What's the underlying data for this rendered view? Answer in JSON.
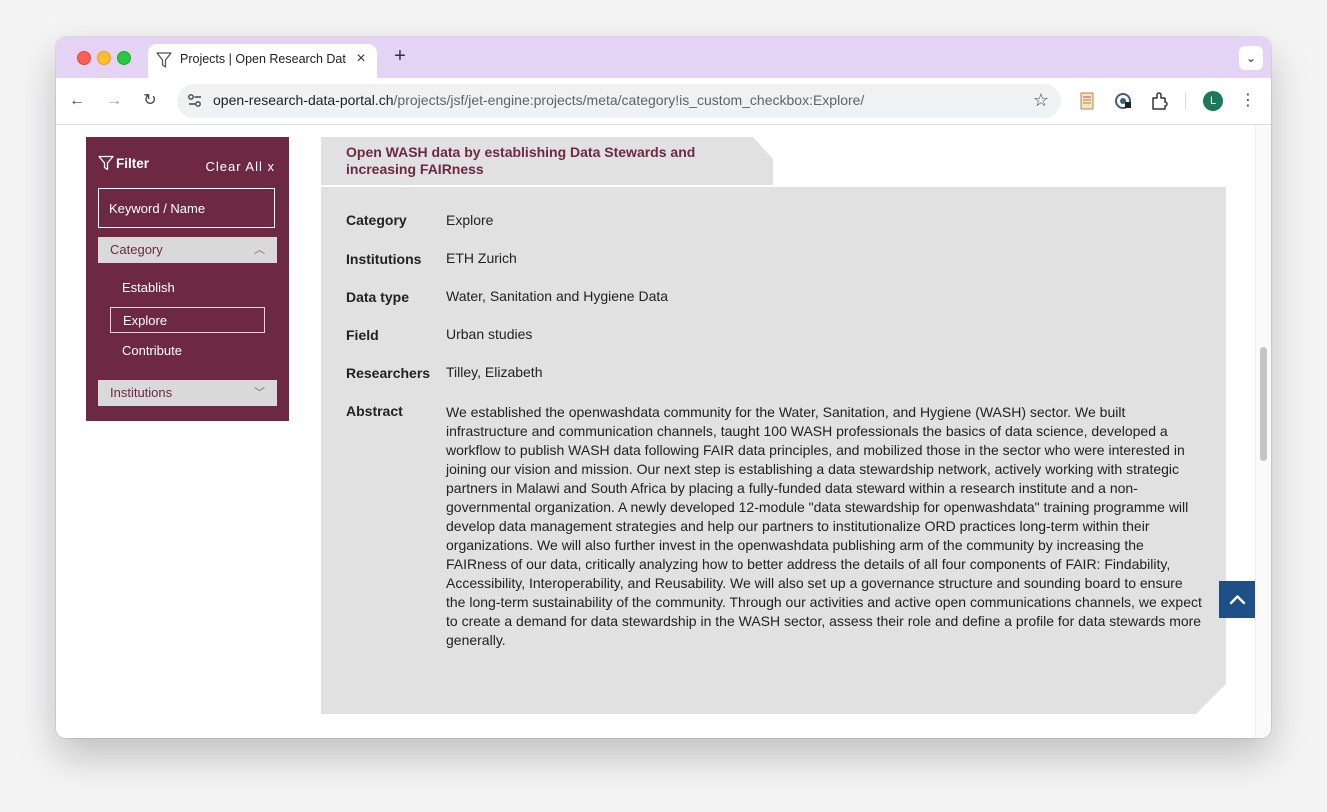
{
  "browser": {
    "tab_title": "Projects | Open Research Data Portal",
    "url_host": "open-research-data-portal.ch",
    "url_path": "/projects/jsf/jet-engine:projects/meta/category!is_custom_checkbox:Explore/",
    "avatar_letter": "L",
    "colors": {
      "tabstrip": "#e4d3f5",
      "avatar": "#1b7a5a"
    }
  },
  "filter": {
    "title": "Filter",
    "clear_all": "Clear All x",
    "keyword_placeholder": "Keyword / Name",
    "category_label": "Category",
    "category_items": [
      "Establish",
      "Explore",
      "Contribute"
    ],
    "selected_category": "Explore",
    "institutions_label": "Institutions",
    "colors": {
      "panel": "#6d2843"
    }
  },
  "project": {
    "title": "Open WASH data by establishing Data Stewards and increasing FAIRness",
    "fields": [
      {
        "label": "Category",
        "value": "Explore"
      },
      {
        "label": "Institutions",
        "value": "ETH Zurich"
      },
      {
        "label": "Data type",
        "value": "Water, Sanitation and Hygiene Data"
      },
      {
        "label": "Field",
        "value": "Urban studies"
      },
      {
        "label": "Researchers",
        "value": "Tilley, Elizabeth"
      }
    ],
    "abstract_label": "Abstract",
    "abstract": "We established the openwashdata community for the Water, Sanitation, and Hygiene (WASH) sector. We built infrastructure and communication channels, taught 100 WASH professionals the basics of data science, developed a workflow to publish WASH data following FAIR data principles, and mobilized those in the sector who were interested in joining our vision and mission. Our next step is establishing a data stewardship network, actively working with strategic partners in Malawi and South Africa by placing a fully-funded data steward within a research institute and a non-governmental organization. A newly developed 12-module \"data stewardship for openwashdata\" training programme will develop data management strategies and help our partners to institutionalize ORD practices long-term within their organizations. We will also further invest in the openwashdata publishing arm of the community by increasing the FAIRness of our data, critically analyzing how to better address the details of all four components of FAIR: Findability, Accessibility, Interoperability, and Reusability. We will also set up a governance structure and sounding board to ensure the long-term sustainability of the community. Through our activities and active open communications channels, we expect to create a demand for data stewardship in the WASH sector, assess their role and define a profile for data stewards more generally.",
    "colors": {
      "card": "#e1e1e1",
      "title": "#6d2843",
      "scroll_top": "#1e4f86"
    }
  },
  "icons": [
    "filter-icon",
    "close-icon",
    "plus-icon",
    "chevron-down-icon",
    "back-icon",
    "forward-icon",
    "reload-icon",
    "site-settings-icon",
    "star-icon",
    "extension-icon",
    "puzzle-icon",
    "kebab-menu-icon",
    "chevron-up-icon",
    "arrow-up-icon"
  ]
}
